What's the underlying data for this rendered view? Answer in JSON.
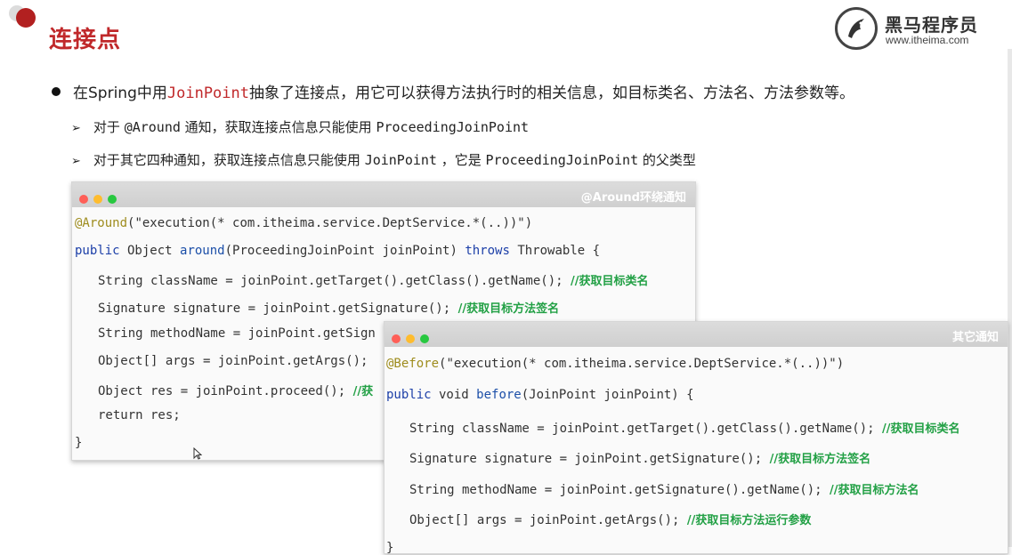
{
  "title": "连接点",
  "logo": {
    "cn_name": "黑马程序员",
    "url": "www.itheima.com"
  },
  "bullet": {
    "prefix": "在Spring中用",
    "highlight": "JoinPoint",
    "suffix": "抽象了连接点，用它可以获得方法执行时的相关信息，如目标类名、方法名、方法参数等。"
  },
  "sub_points": [
    {
      "text_a": "对于 ",
      "code_a": "@Around",
      "text_b": " 通知，获取连接点信息只能使用  ",
      "code_b": "ProceedingJoinPoint",
      "text_c": ""
    },
    {
      "text_a": "对于其它四种通知，获取连接点信息只能使用 ",
      "code_a": "JoinPoint",
      "text_b": " ，它是 ",
      "code_b": "ProceedingJoinPoint",
      "text_c": " 的父类型"
    }
  ],
  "around_window": {
    "title": "@Around环绕通知",
    "annotation": "@Around",
    "annotation_arg": "(\"execution(* com.itheima.service.DeptService.*(..))\")",
    "sig_kw": "public",
    "sig_ret": " Object ",
    "sig_name": "around",
    "sig_params": "(ProceedingJoinPoint joinPoint) ",
    "sig_throws": "throws",
    "sig_tail": " Throwable {",
    "l1_code": "String className = joinPoint.getTarget().getClass().getName(); ",
    "l1_cmt": "//获取目标类名",
    "l2_code": "Signature signature = joinPoint.getSignature(); ",
    "l2_cmt": "//获取目标方法签名",
    "l3_code": "String methodName = joinPoint.getSign",
    "l4_code": "Object[] args = joinPoint.getArgs(); ",
    "l5_code": "Object res = joinPoint.proceed(); ",
    "l5_cmt": "//获",
    "l6_code": "return res;",
    "close": "}"
  },
  "other_window": {
    "title": "其它通知",
    "annotation": "@Before",
    "annotation_arg": "(\"execution(* com.itheima.service.DeptService.*(..))\")",
    "sig_kw": "public",
    "sig_void": " void ",
    "sig_name": "before",
    "sig_params": "(JoinPoint joinPoint) {",
    "l1_code": "String className = joinPoint.getTarget().getClass().getName(); ",
    "l1_cmt": "//获取目标类名",
    "l2_code": "Signature signature = joinPoint.getSignature(); ",
    "l2_cmt": "//获取目标方法签名",
    "l3_code": "String methodName = joinPoint.getSignature().getName(); ",
    "l3_cmt": "//获取目标方法名",
    "l4_code": "Object[] args = joinPoint.getArgs(); ",
    "l4_cmt": "//获取目标方法运行参数",
    "close": "}"
  },
  "colors": {
    "title_red": "#c0282a",
    "keyword_blue": "#1c3fa8",
    "annotation_olive": "#9e8c1d",
    "comment_green": "#22a045"
  }
}
